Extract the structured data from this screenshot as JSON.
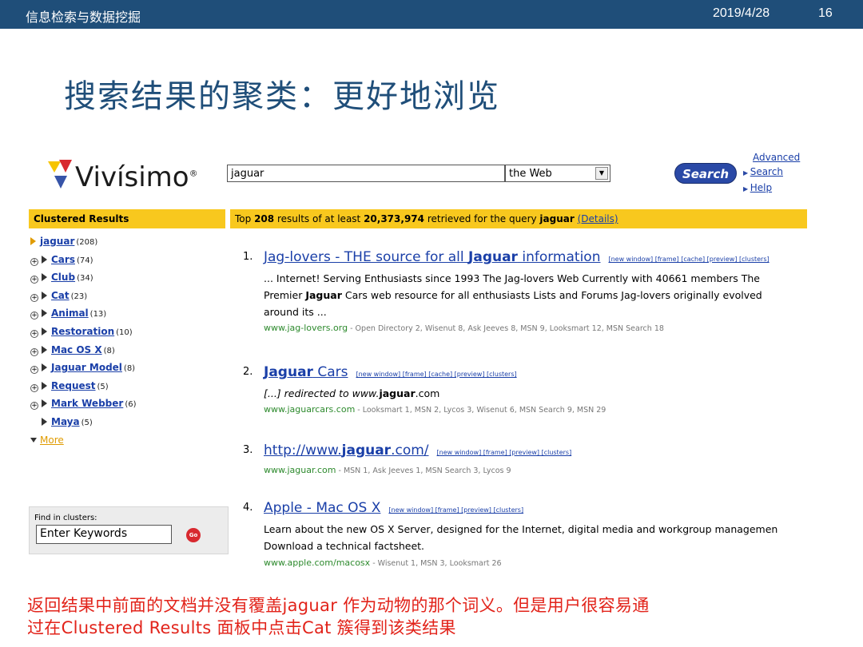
{
  "slide": {
    "course": "信息检索与数据挖掘",
    "date": "2019/4/28",
    "page": "16",
    "title": "搜索结果的聚类：更好地浏览",
    "note_line1": "返回结果中前面的文档并没有覆盖jaguar 作为动物的那个词义。但是用户很容易通",
    "note_line2": "过在Clustered Results 面板中点击Cat 簇得到该类结果"
  },
  "colors": {
    "top_bar": "#1f4e79",
    "title": "#1f4e79",
    "note": "#e2231a",
    "header_band": "#f8c81e",
    "link": "#1a3fa8",
    "url_green": "#2d8a2d"
  },
  "vivisimo": {
    "logo_text": "Vivísimo",
    "logo_mark": "®",
    "query": "jaguar",
    "scope": "the Web",
    "search_button": "Search",
    "advanced_1": "Advanced",
    "advanced_2": "Search",
    "help": "Help",
    "clustered_header": "Clustered Results",
    "results_prefix": "Top ",
    "results_count": "208",
    "results_mid": " results of at least ",
    "results_total": "20,373,974",
    "results_mid2": " retrieved for the query ",
    "results_query": "jaguar",
    "details": "(Details)",
    "clusters": [
      {
        "label": "jaguar",
        "count": "(208)"
      },
      {
        "label": "Cars",
        "count": "(74)"
      },
      {
        "label": "Club",
        "count": "(34)"
      },
      {
        "label": "Cat",
        "count": "(23)"
      },
      {
        "label": "Animal",
        "count": "(13)"
      },
      {
        "label": "Restoration",
        "count": "(10)"
      },
      {
        "label": "Mac OS X",
        "count": "(8)"
      },
      {
        "label": "Jaguar Model",
        "count": "(8)"
      },
      {
        "label": "Request",
        "count": "(5)"
      },
      {
        "label": "Mark Webber",
        "count": "(6)"
      },
      {
        "label": "Maya",
        "count": "(5)"
      }
    ],
    "more": "More",
    "find_label": "Find in clusters:",
    "find_placeholder": "Enter Keywords",
    "go": "Go",
    "results": [
      {
        "num": "1.",
        "title_pre": "Jag-lovers - THE source for all ",
        "title_bold": "Jaguar",
        "title_post": " information",
        "tools": "[new window] [frame] [cache] [preview] [clusters]",
        "snippet_1": "... Internet! Serving Enthusiasts since 1993 The Jag-lovers Web Currently with 40661 members The",
        "snippet_2_pre": "Premier ",
        "snippet_2_bold": "Jaguar",
        "snippet_2_post": " Cars web resource for all enthusiasts Lists and Forums Jag-lovers originally evolved",
        "snippet_3": "around its ...",
        "url": "www.jag-lovers.org",
        "sources": " - Open Directory 2, Wisenut 8, Ask Jeeves 8, MSN 9, Looksmart 12, MSN Search 18"
      },
      {
        "num": "2.",
        "title_bold": "Jaguar",
        "title_post": " Cars",
        "tools": "[new window] [frame] [cache] [preview] [clusters]",
        "snippet_1_pre": "[...] redirected to www.",
        "snippet_1_bold": "jaguar",
        "snippet_1_post": ".com",
        "url": "www.jaguarcars.com",
        "sources": " - Looksmart 1, MSN 2, Lycos 3, Wisenut 6, MSN Search 9, MSN 29"
      },
      {
        "num": "3.",
        "title_pre": "http://www.",
        "title_bold": "jaguar",
        "title_post": ".com/",
        "tools": "[new window] [frame] [preview] [clusters]",
        "url": "www.jaguar.com",
        "sources": " - MSN 1, Ask Jeeves 1, MSN Search 3, Lycos 9"
      },
      {
        "num": "4.",
        "title_pre": "Apple - Mac OS X",
        "tools": "[new window] [frame] [preview] [clusters]",
        "snippet_1": "Learn about the new OS X Server, designed for the Internet, digital media and workgroup managemen",
        "snippet_2": "Download a technical factsheet.",
        "url": "www.apple.com/macosx",
        "sources": " - Wisenut 1, MSN 3, Looksmart 26"
      }
    ]
  }
}
